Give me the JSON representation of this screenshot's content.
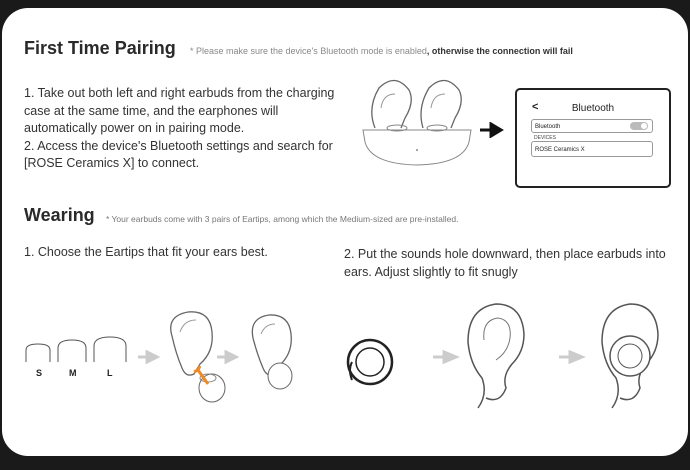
{
  "pairing": {
    "title": "First Time Pairing",
    "note_prefix": "* Please make sure the device's Bluetooth mode is enabled",
    "note_bold": ", otherwise the connection will fail",
    "step1": "1. Take out both left and right earbuds from the charging case at the same time, and the earphones will automatically power on in pairing mode.",
    "step2": "2. Access the device's Bluetooth settings and search for [ROSE Ceramics X] to connect.",
    "phone": {
      "back": "<",
      "title": "Bluetooth",
      "toggle_label": "Bluetooth",
      "devices_label": "DEVICES",
      "device_name": "ROSE Ceramics X"
    }
  },
  "wearing": {
    "title": "Wearing",
    "note": "* Your earbuds come with 3 pairs of Eartips, among which the Medium-sized are pre-installed.",
    "step1": "1. Choose the Eartips that fit your ears best.",
    "step2": "2. Put the sounds hole downward, then place earbuds into ears. Adjust slightly to fit snugly",
    "sizes": [
      "S",
      "M",
      "L"
    ]
  }
}
